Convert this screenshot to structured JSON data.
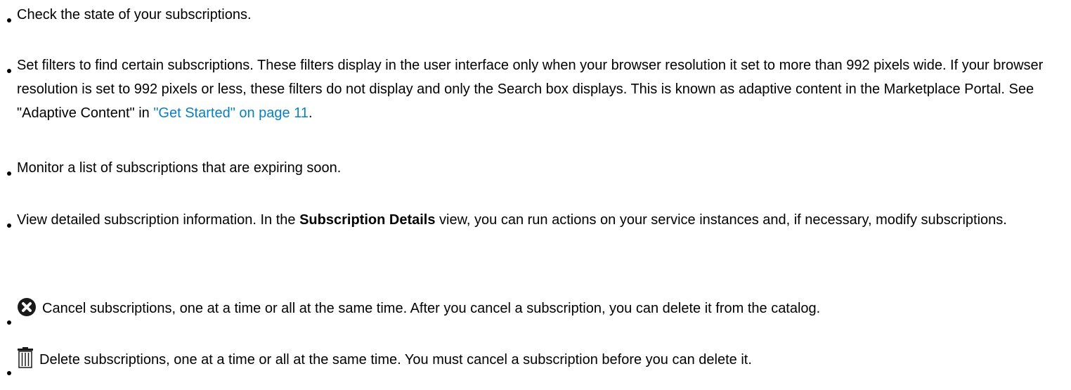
{
  "items": [
    {
      "text": "Check the state of your subscriptions."
    },
    {
      "text_before_link": "Set filters to find certain subscriptions. These filters display in the user interface only when your browser resolution it set to more than 992 pixels wide. If your browser resolution is set to 992 pixels or less, these filters do not display and only the Search box displays. This is known as adaptive content in the Marketplace Portal. See \"Adaptive Content\" in ",
      "link_text": "\"Get Started\" on page 11",
      "text_after_link": "."
    },
    {
      "text": "Monitor a list of subscriptions that are expiring soon."
    },
    {
      "text_before_bold": "View detailed subscription information. In the ",
      "bold_text": "Subscription Details",
      "text_after_bold": " view, you can run actions on your service instances and, if necessary, modify subscriptions."
    },
    {
      "icon": "cancel-icon",
      "text": "Cancel subscriptions, one at a time or all at the same time. After you cancel a subscription, you can delete it from the catalog."
    },
    {
      "icon": "trash-icon",
      "text": "Delete subscriptions, one at a time or all at the same time. You must cancel a subscription before you can delete it."
    }
  ],
  "colors": {
    "link": "#0a7fc0",
    "text": "#000000"
  }
}
